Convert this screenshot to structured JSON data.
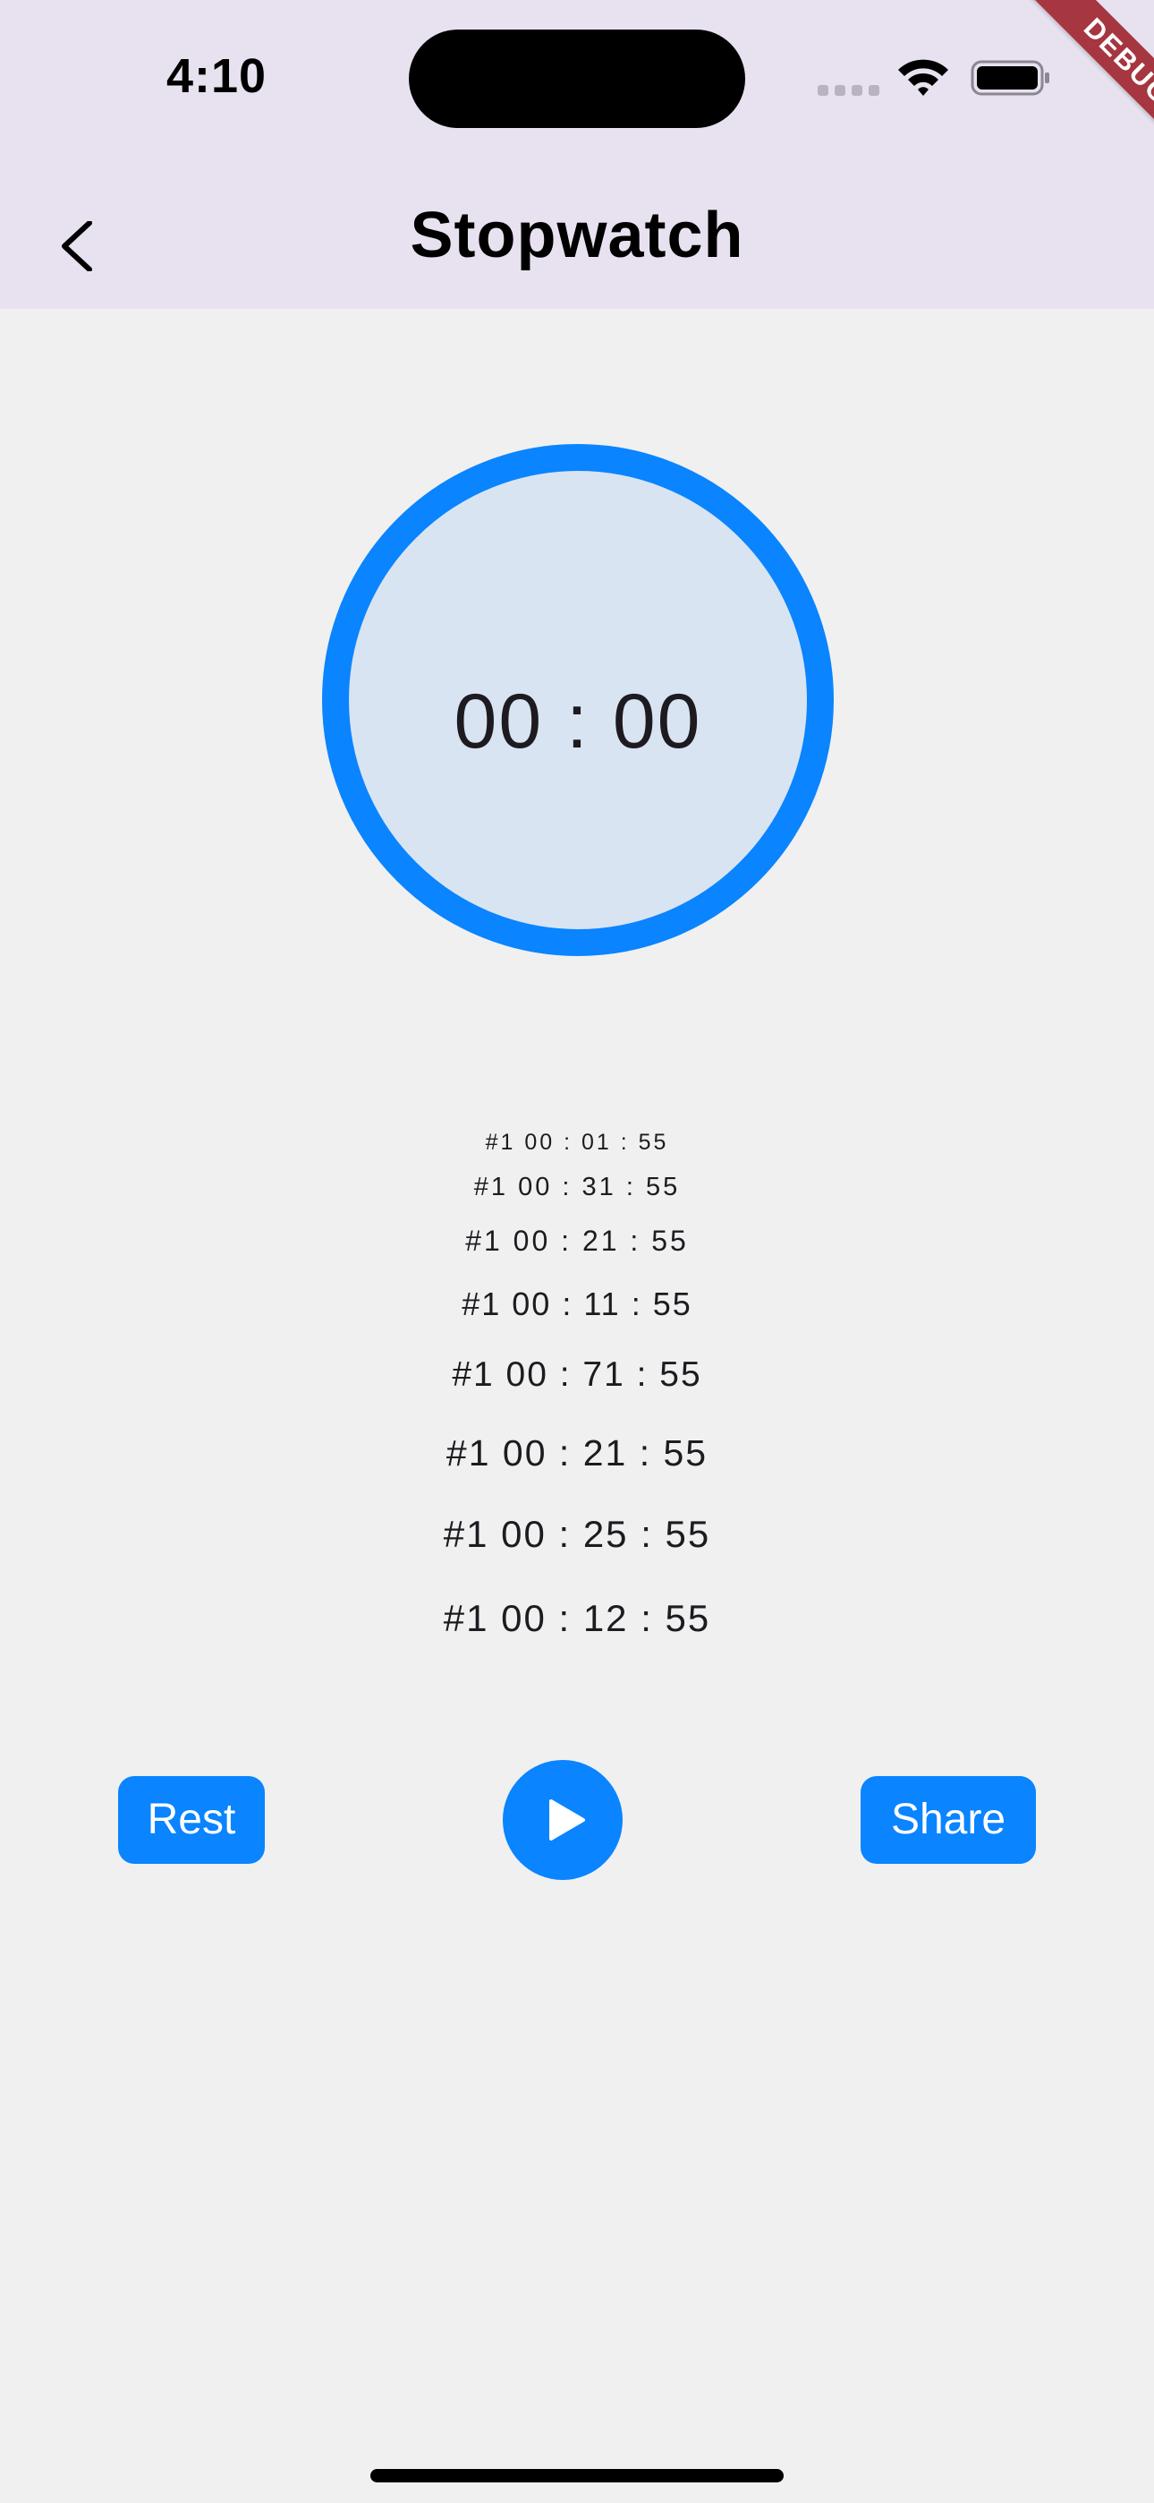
{
  "status_bar": {
    "time": "4:10",
    "icons": [
      "signal-icon",
      "wifi-icon",
      "battery-icon"
    ]
  },
  "debug_banner": "DEBUG",
  "app_bar": {
    "back_icon": "chevron-left-icon",
    "title": "Stopwatch"
  },
  "timer": {
    "display": "00 : 00"
  },
  "laps": [
    "#1 00 : 01 : 55",
    "#1 00 : 31 : 55",
    "#1 00 : 21 : 55",
    "#1 00 : 11 : 55",
    "#1 00 : 71 : 55",
    "#1 00 : 21 : 55",
    "#1 00 : 25 : 55",
    "#1 00 : 12 : 55"
  ],
  "controls": {
    "reset_label": "Rest",
    "play_icon": "play-icon",
    "share_label": "Share"
  },
  "colors": {
    "accent": "#0a84ff",
    "app_bar_bg": "#e8e2f0",
    "page_bg": "#f0f0f0",
    "timer_fill": "#d8e4f2",
    "debug_ribbon": "#a6363f"
  }
}
